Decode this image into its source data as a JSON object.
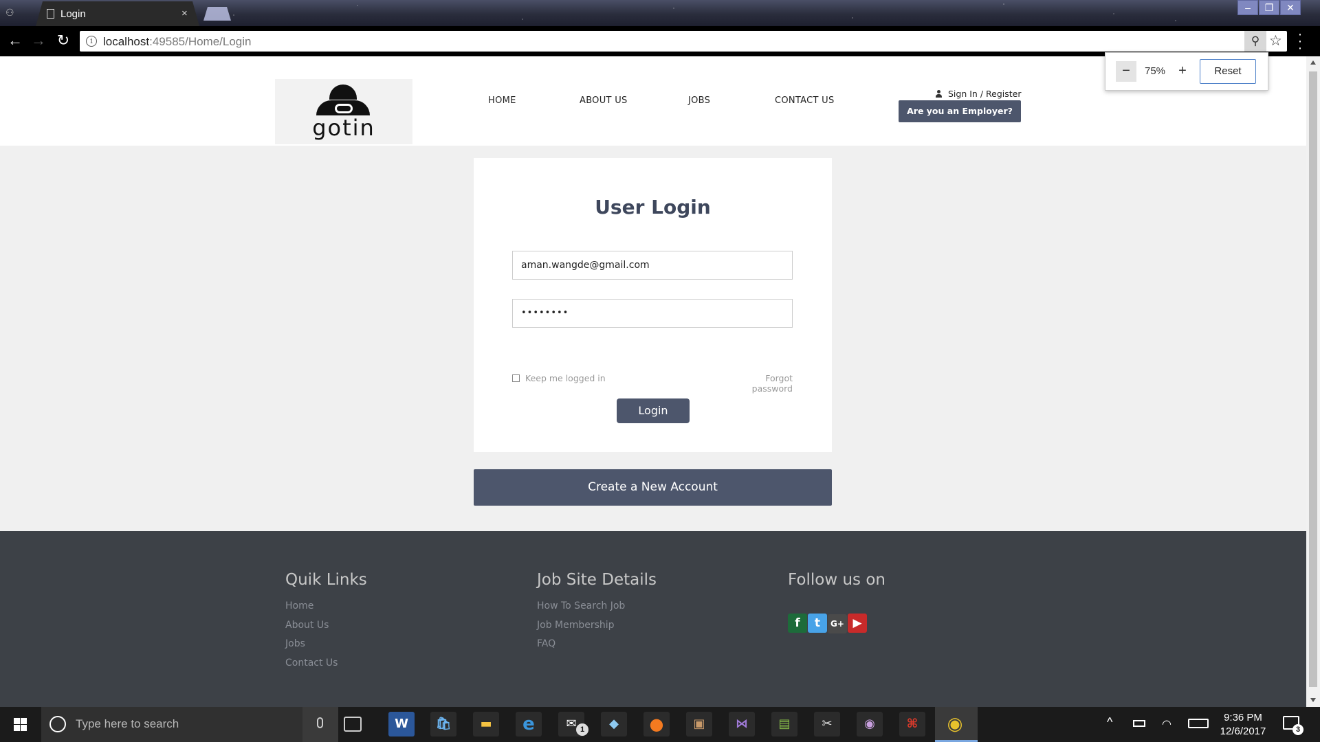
{
  "browser": {
    "tab_title": "Login",
    "tab_close": "×",
    "url_host": "localhost",
    "url_rest": ":49585/Home/Login",
    "info_glyph": "i",
    "zoom_glyph": "⚲",
    "star_glyph": "☆",
    "menu_glyph": "⋮",
    "back_glyph": "←",
    "forward_glyph": "→",
    "reload_glyph": "↻",
    "window_minimize": "–",
    "window_restore": "❐",
    "window_close": "✕"
  },
  "zoom_popup": {
    "minus": "−",
    "level": "75%",
    "plus": "+",
    "reset": "Reset"
  },
  "header": {
    "logo_text": "gotin",
    "nav": [
      "HOME",
      "ABOUT US",
      "JOBS",
      "CONTACT US"
    ],
    "signin": "Sign In",
    "signin_sep": " / ",
    "register": "Register",
    "employer_button": "Are you an Employer?"
  },
  "login": {
    "title": "User Login",
    "email_value": "aman.wangde@gmail.com",
    "password_value": "••••••••",
    "keep_logged_in": "Keep me logged in",
    "forgot_password": "Forgot password",
    "login_button": "Login",
    "create_account_button": "Create a New Account"
  },
  "footer": {
    "quick_links": {
      "heading": "Quik Links",
      "items": [
        "Home",
        "About Us",
        "Jobs",
        "Contact Us"
      ]
    },
    "job_site": {
      "heading": "Job Site Details",
      "items": [
        "How To Search Job",
        "Job Membership",
        "FAQ"
      ]
    },
    "follow": {
      "heading": "Follow us on",
      "icons": [
        {
          "name": "facebook-icon",
          "glyph": "f",
          "color": "#1d6b3a"
        },
        {
          "name": "twitter-icon",
          "glyph": "t",
          "color": "#48a3e8"
        },
        {
          "name": "google-plus-icon",
          "glyph": "G+",
          "color": "#4a4a4a"
        },
        {
          "name": "youtube-icon",
          "glyph": "▶",
          "color": "#c82a2a"
        }
      ]
    }
  },
  "taskbar": {
    "search_placeholder": "Type here to search",
    "time": "9:36 PM",
    "date": "12/6/2017",
    "mail_badge": "1",
    "notification_count": "3",
    "caret_glyph": "^"
  },
  "colors": {
    "accent": "#4d566c",
    "footer_bg": "#3d4147",
    "title_color": "#3e475c"
  }
}
